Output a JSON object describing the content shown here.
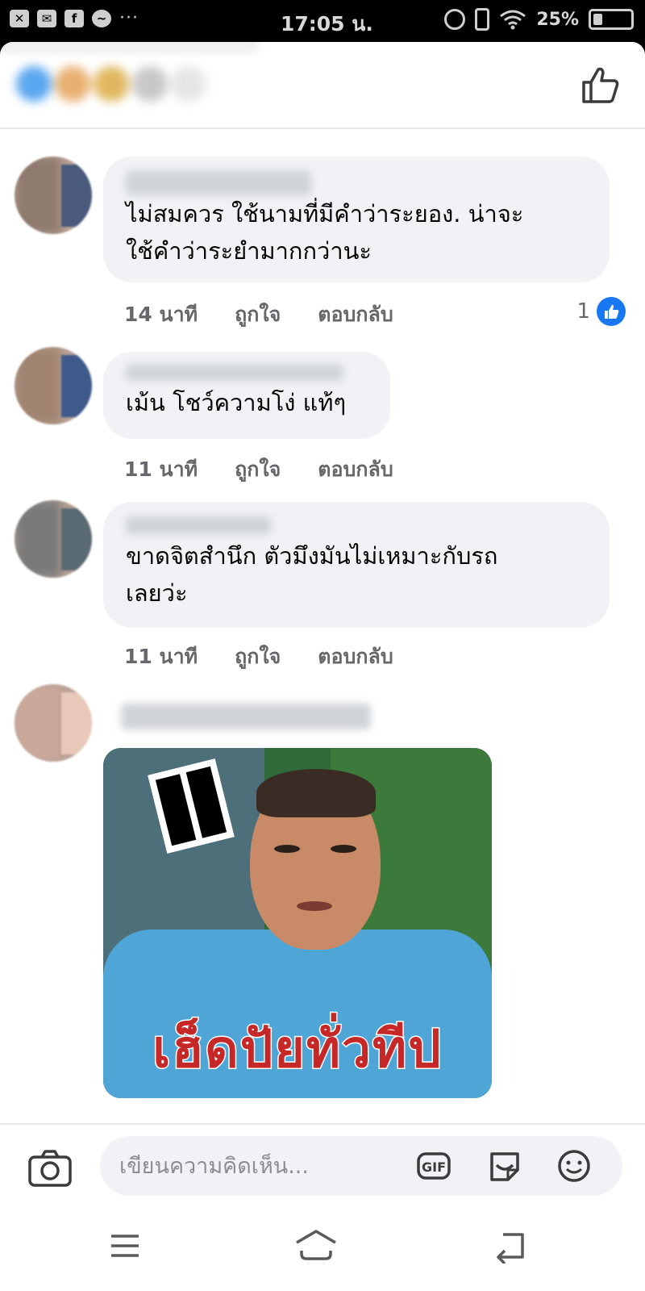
{
  "status_bar": {
    "time": "17:05 น.",
    "battery": "25%",
    "battery_level": 0.25,
    "left_icons": [
      "x-icon",
      "mail-icon",
      "facebook-icon",
      "messenger-icon"
    ],
    "more": "···"
  },
  "colors": {
    "accent": "#1877f2",
    "bubble": "#f0f2f5",
    "meta_text": "#65676b"
  },
  "comments": [
    {
      "text_line1": "ไม่สมควร ใช้นามที่มีคำว่าระยอง. น่าจะ",
      "text_line2": "ใช้คำว่าระยำมากกว่านะ",
      "time": "14 นาที",
      "like": "ถูกใจ",
      "reply": "ตอบกลับ",
      "reactions": "1"
    },
    {
      "text_line1": "เม้น โชว์ความโง่ แท้ๆ",
      "time": "11 นาที",
      "like": "ถูกใจ",
      "reply": "ตอบกลับ"
    },
    {
      "text_line1": "ขาดจิตสำนึก ตัวมึงมันไม่เหมาะกับรถ",
      "text_line2": "เลยว่ะ",
      "time": "11 นาที",
      "like": "ถูกใจ",
      "reply": "ตอบกลับ"
    }
  ],
  "sticker": {
    "caption": "เฮ็ดปัยทั่วทีป"
  },
  "composer": {
    "placeholder": "เขียนความคิดเห็น...",
    "gif_label": "GIF"
  }
}
